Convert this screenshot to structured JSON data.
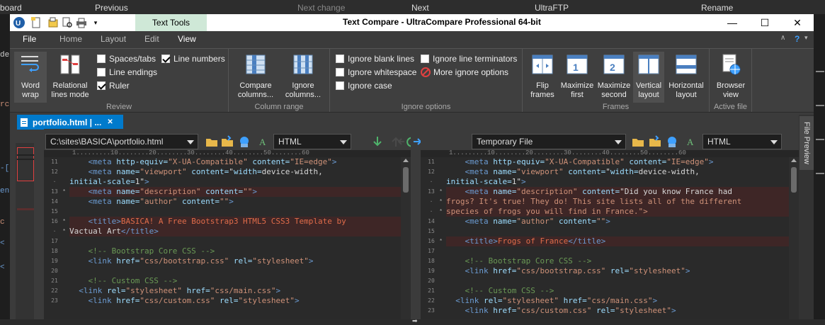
{
  "background": {
    "top_labels": [
      "board",
      "Previous",
      "Next change",
      "Next",
      "UltraFTP",
      "Rename"
    ],
    "left_fragments": [
      "dex",
      "rc",
      "-[",
      "en",
      "c",
      "<",
      "<"
    ]
  },
  "window": {
    "title": "Text Compare - UltraCompare Professional 64-bit",
    "context_tab": "Text Tools",
    "controls": {
      "minimize": "—",
      "maximize": "☐",
      "close": "✕"
    }
  },
  "menu": {
    "items": [
      "File",
      "Home",
      "Layout",
      "Edit",
      "View"
    ],
    "help": "?"
  },
  "ribbon": {
    "review": {
      "label": "Review",
      "word_wrap": "Word wrap",
      "relational": "Relational lines mode",
      "spaces_tabs": "Spaces/tabs",
      "line_endings": "Line endings",
      "ruler": "Ruler",
      "line_numbers": "Line numbers",
      "checked": {
        "spaces_tabs": false,
        "line_endings": false,
        "ruler": true,
        "line_numbers": true
      }
    },
    "column_range": {
      "label": "Column range",
      "compare_columns": "Compare columns...",
      "ignore_columns": "Ignore columns..."
    },
    "ignore": {
      "label": "Ignore options",
      "blank_lines": "Ignore blank lines",
      "whitespace": "Ignore whitespace",
      "case": "Ignore case",
      "terminators": "Ignore line terminators",
      "more": "More ignore options"
    },
    "frames": {
      "label": "Frames",
      "flip": "Flip frames",
      "max_first": "Maximize first",
      "max_second": "Maximize second",
      "vertical": "Vertical layout",
      "horizontal": "Horizontal layout"
    },
    "active_file": {
      "label": "Active file",
      "browser": "Browser view"
    }
  },
  "doc_tab": {
    "label": "portfolio.html | ...",
    "close": "✕"
  },
  "side_panel": "File Preview",
  "left_pane": {
    "path": "C:\\sites\\BASICA\\portfolio.html",
    "syntax": "HTML",
    "ruler": "1.........10........20........30........40........50........60"
  },
  "right_pane": {
    "path": "Temporary File",
    "syntax": "HTML",
    "ruler": "1.........10........20........30........40........50........60"
  },
  "left_lines": [
    {
      "no": "11",
      "text": "    <meta http-equiv=\"X-UA-Compatible\" content=\"IE=edge\">",
      "diff": false
    },
    {
      "no": "12",
      "text": "    <meta name=\"viewport\" content=\"width=device-width,",
      "diff": false
    },
    {
      "no": "·",
      "text": "initial-scale=1\">",
      "diff": false
    },
    {
      "no": "13",
      "text": "    <meta name=\"description\" content=\"\">",
      "diff": true
    },
    {
      "no": "14",
      "text": "    <meta name=\"author\" content=\"\">",
      "diff": false
    },
    {
      "no": "15",
      "text": "",
      "diff": false
    },
    {
      "no": "16",
      "text": "    <title>BASICA! A Free Bootstrap3 HTML5 CSS3 Template by",
      "diff": true
    },
    {
      "no": "·",
      "text": "Vactual Art</title>",
      "diff": true
    },
    {
      "no": "17",
      "text": "",
      "diff": false
    },
    {
      "no": "18",
      "text": "    <!-- Bootstrap Core CSS -->",
      "diff": false
    },
    {
      "no": "19",
      "text": "    <link href=\"css/bootstrap.css\" rel=\"stylesheet\">",
      "diff": false
    },
    {
      "no": "20",
      "text": "",
      "diff": false
    },
    {
      "no": "21",
      "text": "    <!-- Custom CSS -->",
      "diff": false
    },
    {
      "no": "22",
      "text": "  <link rel=\"stylesheet\" href=\"css/main.css\">",
      "diff": false
    },
    {
      "no": "23",
      "text": "    <link href=\"css/custom.css\" rel=\"stylesheet\">",
      "diff": false
    }
  ],
  "right_lines": [
    {
      "no": "11",
      "text": "    <meta http-equiv=\"X-UA-Compatible\" content=\"IE=edge\">",
      "diff": false
    },
    {
      "no": "12",
      "text": "    <meta name=\"viewport\" content=\"width=device-width,",
      "diff": false
    },
    {
      "no": "·",
      "text": "initial-scale=1\">",
      "diff": false
    },
    {
      "no": "13",
      "text": "    <meta name=\"description\" content=\"Did you know France had",
      "diff": true
    },
    {
      "no": "·",
      "text": "frogs? It's true! They do! This site lists all of the different",
      "diff": true
    },
    {
      "no": "·",
      "text": "species of frogs you will find in France.\">",
      "diff": true
    },
    {
      "no": "14",
      "text": "    <meta name=\"author\" content=\"\">",
      "diff": false
    },
    {
      "no": "15",
      "text": "",
      "diff": false
    },
    {
      "no": "16",
      "text": "    <title>Frogs of France</title>",
      "diff": true
    },
    {
      "no": "17",
      "text": "",
      "diff": false
    },
    {
      "no": "18",
      "text": "    <!-- Bootstrap Core CSS -->",
      "diff": false
    },
    {
      "no": "19",
      "text": "    <link href=\"css/bootstrap.css\" rel=\"stylesheet\">",
      "diff": false
    },
    {
      "no": "20",
      "text": "",
      "diff": false
    },
    {
      "no": "21",
      "text": "    <!-- Custom CSS -->",
      "diff": false
    },
    {
      "no": "22",
      "text": "  <link rel=\"stylesheet\" href=\"css/main.css\">",
      "diff": false
    },
    {
      "no": "23",
      "text": "    <link href=\"css/custom.css\" rel=\"stylesheet\">",
      "diff": false
    }
  ],
  "colors": {
    "accent": "#007acc",
    "diff_bg": "#3e2626",
    "context_tab": "#cfe8d7"
  }
}
